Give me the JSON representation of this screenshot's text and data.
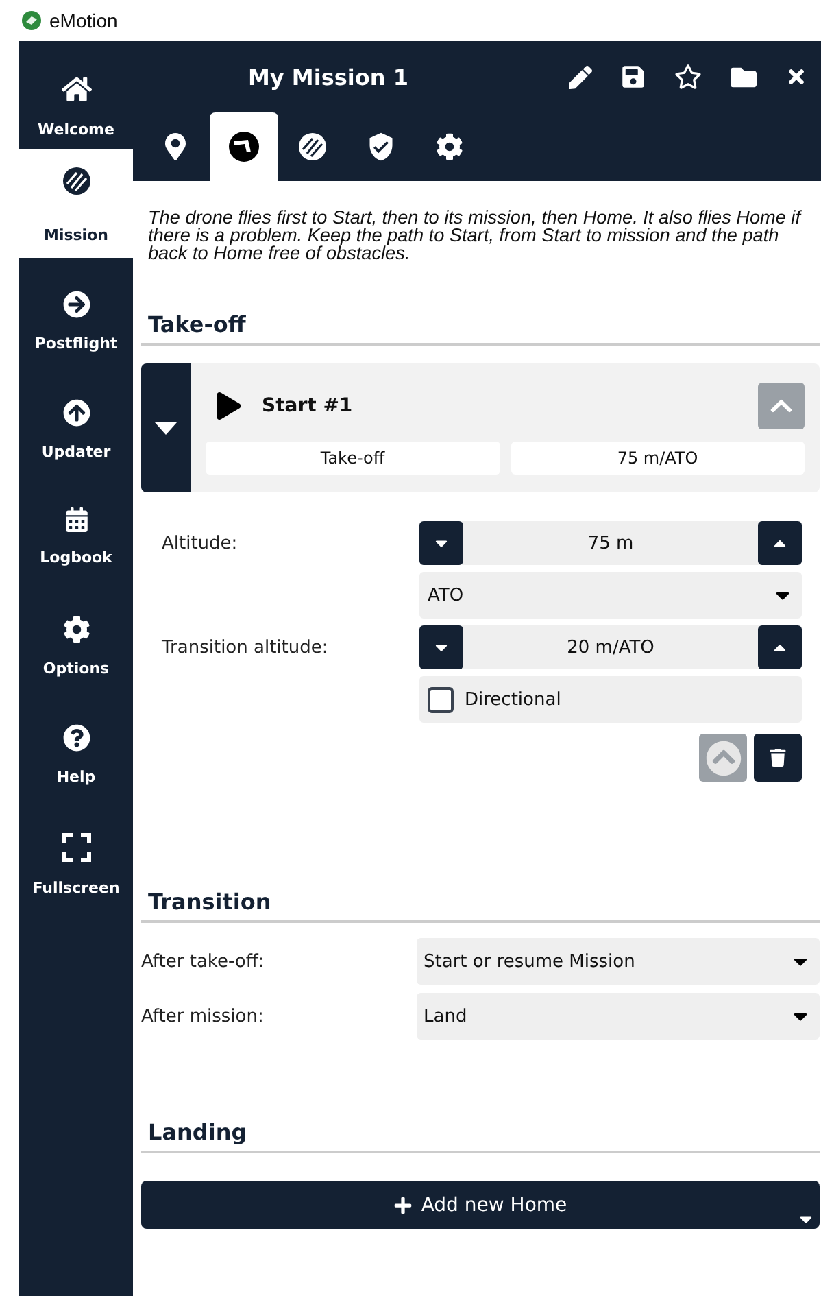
{
  "app": {
    "title": "eMotion"
  },
  "sidebar": [
    {
      "kind": "home",
      "label": "Welcome",
      "selected": false
    },
    {
      "kind": "mission",
      "label": "Mission",
      "selected": true
    },
    {
      "kind": "postflight",
      "label": "Postflight",
      "selected": false
    },
    {
      "kind": "updater",
      "label": "Updater",
      "selected": false
    },
    {
      "kind": "logbook",
      "label": "Logbook",
      "selected": false
    },
    {
      "kind": "options",
      "label": "Options",
      "selected": false
    },
    {
      "kind": "help",
      "label": "Help",
      "selected": false
    },
    {
      "kind": "fullscreen",
      "label": "Fullscreen",
      "selected": false
    }
  ],
  "header": {
    "title": "My Mission 1"
  },
  "tabs": [
    {
      "kind": "pin",
      "selected": false
    },
    {
      "kind": "takeoff",
      "selected": true
    },
    {
      "kind": "mission",
      "selected": false
    },
    {
      "kind": "shield",
      "selected": false
    },
    {
      "kind": "settings",
      "selected": false
    }
  ],
  "description": "The drone flies first to Start, then to its mission, then Home. It also flies Home if there is a problem. Keep the path to Start, from Start to mission and the path back to Home free of obstacles.",
  "take_off": {
    "heading": "Take-off",
    "start": {
      "title": "Start #1",
      "expanded": true,
      "type": "Take-off",
      "summary": "75 m/ATO"
    },
    "altitude": {
      "label": "Altitude:",
      "value": "75 m",
      "reference": "ATO"
    },
    "transition_altitude": {
      "label": "Transition altitude:",
      "value": "20 m/ATO"
    },
    "directional": {
      "label": "Directional",
      "checked": false
    },
    "move_up": {
      "disabled": true
    }
  },
  "transition": {
    "heading": "Transition",
    "rows": [
      {
        "label": "After take-off:",
        "value": "Start or resume Mission"
      },
      {
        "label": "After mission:",
        "value": "Land"
      }
    ]
  },
  "landing": {
    "heading": "Landing",
    "add_button": "Add new Home"
  }
}
